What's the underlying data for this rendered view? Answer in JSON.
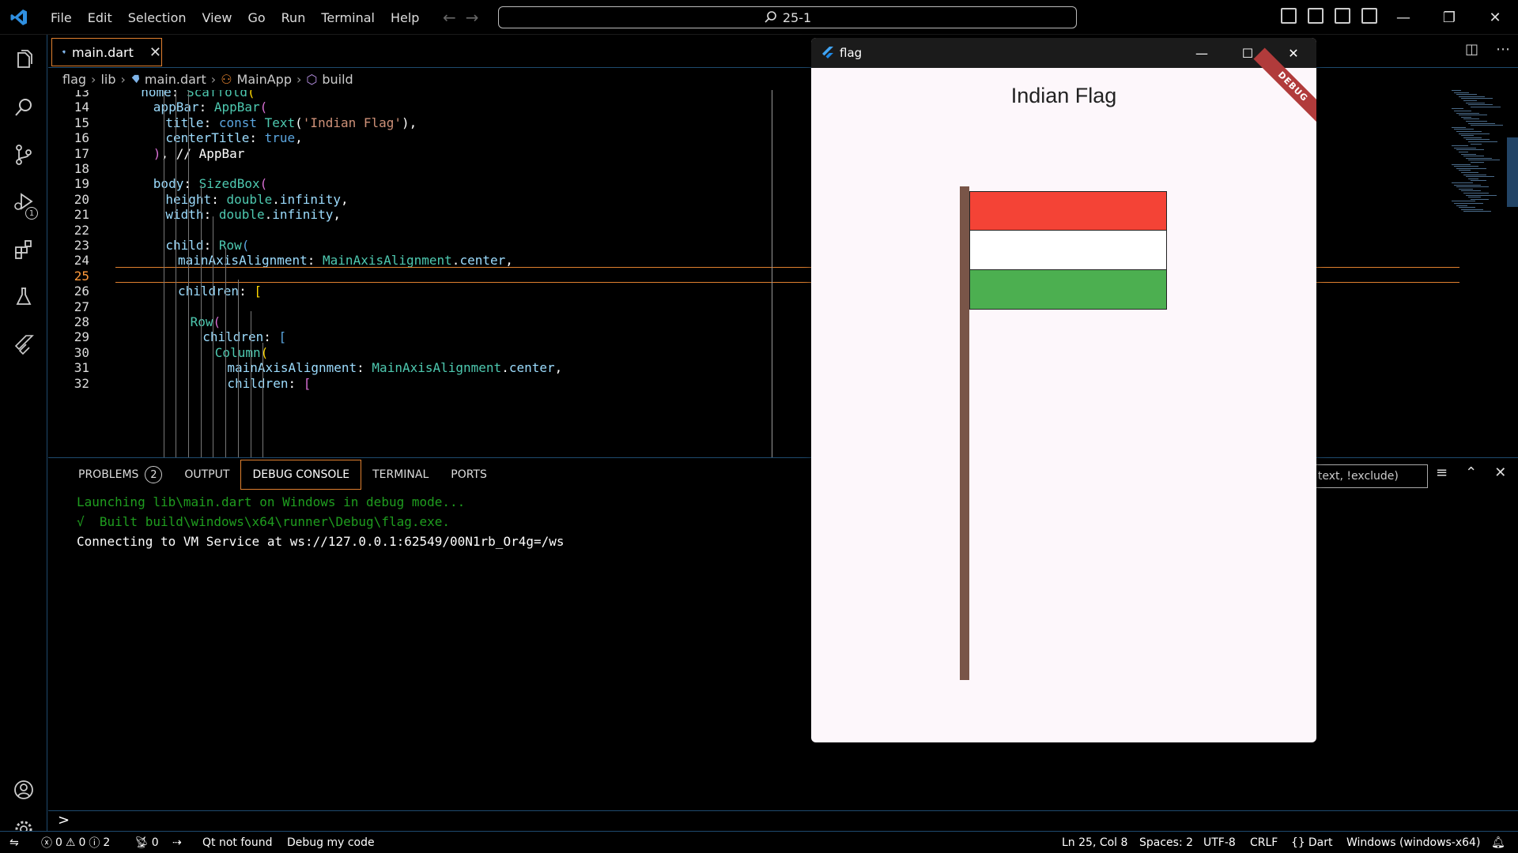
{
  "titlebar": {
    "menu": [
      "File",
      "Edit",
      "Selection",
      "View",
      "Go",
      "Run",
      "Terminal",
      "Help"
    ],
    "command_center": "25-1"
  },
  "editor": {
    "tab": "main.dart",
    "breadcrumb": [
      "flag",
      "lib",
      "main.dart",
      "MainApp",
      "build"
    ],
    "lines": [
      {
        "n": "13",
        "indent": 2,
        "tokens": [
          [
            "p",
            "home"
          ],
          [
            "w",
            ": "
          ],
          [
            "c",
            "Scaffold"
          ],
          [
            "y",
            "("
          ]
        ]
      },
      {
        "n": "14",
        "indent": 3,
        "tokens": [
          [
            "p",
            "appBar"
          ],
          [
            "w",
            ": "
          ],
          [
            "c",
            "AppBar"
          ],
          [
            "m",
            "("
          ]
        ]
      },
      {
        "n": "15",
        "indent": 4,
        "tokens": [
          [
            "p",
            "title"
          ],
          [
            "w",
            ": "
          ],
          [
            "k",
            "const "
          ],
          [
            "c",
            "Text"
          ],
          [
            "w",
            "("
          ],
          [
            "s",
            "'Indian Flag'"
          ],
          [
            "w",
            "),"
          ]
        ]
      },
      {
        "n": "16",
        "indent": 4,
        "tokens": [
          [
            "p",
            "centerTitle"
          ],
          [
            "w",
            ": "
          ],
          [
            "k",
            "true"
          ],
          [
            "w",
            ","
          ]
        ]
      },
      {
        "n": "17",
        "indent": 3,
        "tokens": [
          [
            "m",
            ")"
          ],
          [
            "w",
            ", "
          ],
          [
            "cm",
            "// AppBar"
          ]
        ]
      },
      {
        "n": "18",
        "indent": 0,
        "tokens": []
      },
      {
        "n": "19",
        "indent": 3,
        "tokens": [
          [
            "p",
            "body"
          ],
          [
            "w",
            ": "
          ],
          [
            "c",
            "SizedBox"
          ],
          [
            "m",
            "("
          ]
        ]
      },
      {
        "n": "20",
        "indent": 4,
        "tokens": [
          [
            "p",
            "height"
          ],
          [
            "w",
            ": "
          ],
          [
            "c",
            "double"
          ],
          [
            "w",
            "."
          ],
          [
            "p",
            "infinity"
          ],
          [
            "w",
            ","
          ]
        ]
      },
      {
        "n": "21",
        "indent": 4,
        "tokens": [
          [
            "p",
            "width"
          ],
          [
            "w",
            ": "
          ],
          [
            "c",
            "double"
          ],
          [
            "w",
            "."
          ],
          [
            "p",
            "infinity"
          ],
          [
            "w",
            ","
          ]
        ]
      },
      {
        "n": "22",
        "indent": 0,
        "tokens": []
      },
      {
        "n": "23",
        "indent": 4,
        "tokens": [
          [
            "p",
            "child"
          ],
          [
            "w",
            ": "
          ],
          [
            "c",
            "Row"
          ],
          [
            "k",
            "("
          ]
        ]
      },
      {
        "n": "24",
        "indent": 5,
        "tokens": [
          [
            "p",
            "mainAxisAlignment"
          ],
          [
            "w",
            ": "
          ],
          [
            "c",
            "MainAxisAlignment"
          ],
          [
            "w",
            "."
          ],
          [
            "p",
            "center"
          ],
          [
            "w",
            ","
          ]
        ]
      },
      {
        "n": "25",
        "indent": 0,
        "tokens": [],
        "active": true
      },
      {
        "n": "26",
        "indent": 5,
        "tokens": [
          [
            "p",
            "children"
          ],
          [
            "w",
            ": "
          ],
          [
            "y",
            "["
          ]
        ]
      },
      {
        "n": "27",
        "indent": 0,
        "tokens": []
      },
      {
        "n": "28",
        "indent": 6,
        "tokens": [
          [
            "c",
            "Row"
          ],
          [
            "m",
            "("
          ]
        ]
      },
      {
        "n": "29",
        "indent": 7,
        "tokens": [
          [
            "p",
            "children"
          ],
          [
            "w",
            ": "
          ],
          [
            "k",
            "["
          ]
        ]
      },
      {
        "n": "30",
        "indent": 8,
        "tokens": [
          [
            "c",
            "Column"
          ],
          [
            "y",
            "("
          ]
        ]
      },
      {
        "n": "31",
        "indent": 9,
        "tokens": [
          [
            "p",
            "mainAxisAlignment"
          ],
          [
            "w",
            ": "
          ],
          [
            "c",
            "MainAxisAlignment"
          ],
          [
            "w",
            "."
          ],
          [
            "p",
            "center"
          ],
          [
            "w",
            ","
          ]
        ]
      },
      {
        "n": "32",
        "indent": 9,
        "tokens": [
          [
            "p",
            "children"
          ],
          [
            "w",
            ": "
          ],
          [
            "m",
            "["
          ]
        ]
      }
    ]
  },
  "panel": {
    "tabs": [
      {
        "label": "PROBLEMS",
        "count": "2"
      },
      {
        "label": "OUTPUT"
      },
      {
        "label": "DEBUG CONSOLE",
        "active": true
      },
      {
        "label": "TERMINAL"
      },
      {
        "label": "PORTS"
      }
    ],
    "filter_placeholder": "Filter (e.g. text, !exclude)",
    "filter_visible": ", text, !exclude)",
    "console": [
      {
        "text": "Launching lib\\main.dart on Windows in debug mode...",
        "style": "green"
      },
      {
        "text": "√  Built build\\windows\\x64\\runner\\Debug\\flag.exe.",
        "style": "green"
      },
      {
        "text": "Connecting to VM Service at ws://127.0.0.1:62549/00N1rb_Or4g=/ws",
        "style": "white"
      }
    ],
    "repl_prompt": ">"
  },
  "statusbar": {
    "errors": "0",
    "warnings": "0",
    "infos": "2",
    "ports": "0",
    "qt": "Qt not found",
    "debug_my_code": "Debug my code",
    "position": "Ln 25, Col 8",
    "spaces": "Spaces: 2",
    "encoding": "UTF-8",
    "eol": "CRLF",
    "language": "Dart",
    "device": "Windows (windows-x64)"
  },
  "flutter_window": {
    "title": "flag",
    "appbar_title": "Indian Flag",
    "debug_banner": "DEBUG",
    "colors": {
      "saffron": "#f44336",
      "white": "#ffffff",
      "green": "#4caf50",
      "pole": "#795548",
      "chakra": "#1a237e"
    }
  },
  "activitybar": {
    "icons": [
      "explorer-icon",
      "search-icon",
      "source-control-icon",
      "run-debug-icon",
      "extensions-icon",
      "testing-icon",
      "flutter-icon"
    ],
    "run_debug_badge": "1"
  }
}
